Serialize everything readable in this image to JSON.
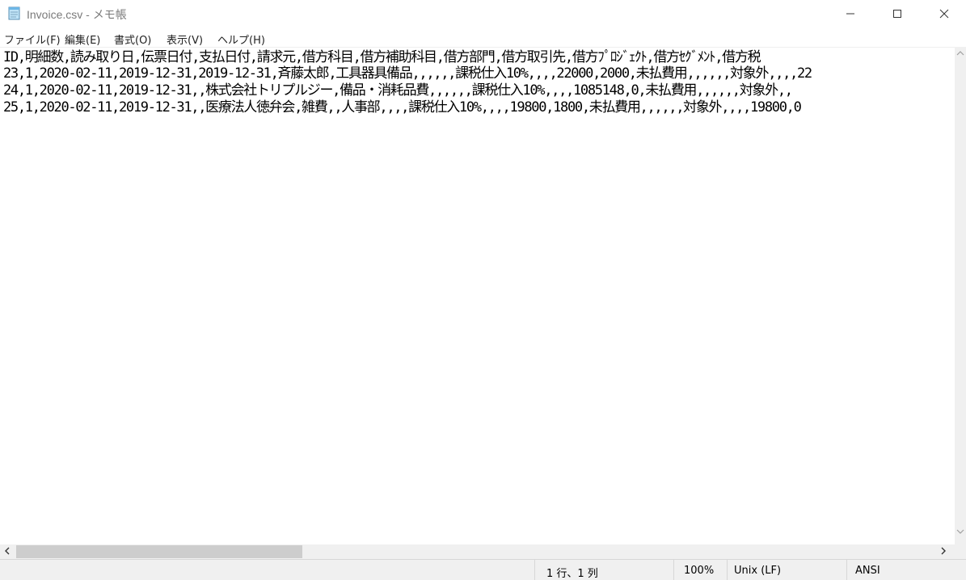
{
  "window": {
    "title": "Invoice.csv - メモ帳",
    "icon": "notepad-icon"
  },
  "menu": [
    {
      "label": "ファイル(F)"
    },
    {
      "label": "編集(E)"
    },
    {
      "label": "書式(O)"
    },
    {
      "label": "表示(V)"
    },
    {
      "label": "ヘルプ(H)"
    }
  ],
  "editor": {
    "lines": [
      "ID,明細数,読み取り日,伝票日付,支払日付,請求元,借方科目,借方補助科目,借方部門,借方取引先,借方ﾌﾟﾛｼﾞｪｸﾄ,借方ｾｸﾞﾒﾝﾄ,借方税",
      "23,1,2020-02-11,2019-12-31,2019-12-31,斉藤太郎,工具器具備品,,,,,,課税仕入10%,,,,22000,2000,未払費用,,,,,,対象外,,,,22",
      "24,1,2020-02-11,2019-12-31,,株式会社トリプルジー,備品・消耗品費,,,,,,課税仕入10%,,,,1085148,0,未払費用,,,,,,対象外,,",
      "25,1,2020-02-11,2019-12-31,,医療法人徳弁会,雑費,,人事部,,,,課税仕入10%,,,,19800,1800,未払費用,,,,,,対象外,,,,19800,0"
    ]
  },
  "status": {
    "position": "1 行、1 列",
    "zoom": "100%",
    "line_ending": "Unix (LF)",
    "encoding": "ANSI"
  },
  "scroll": {
    "horizontal_thumb_fraction": 0.31
  }
}
